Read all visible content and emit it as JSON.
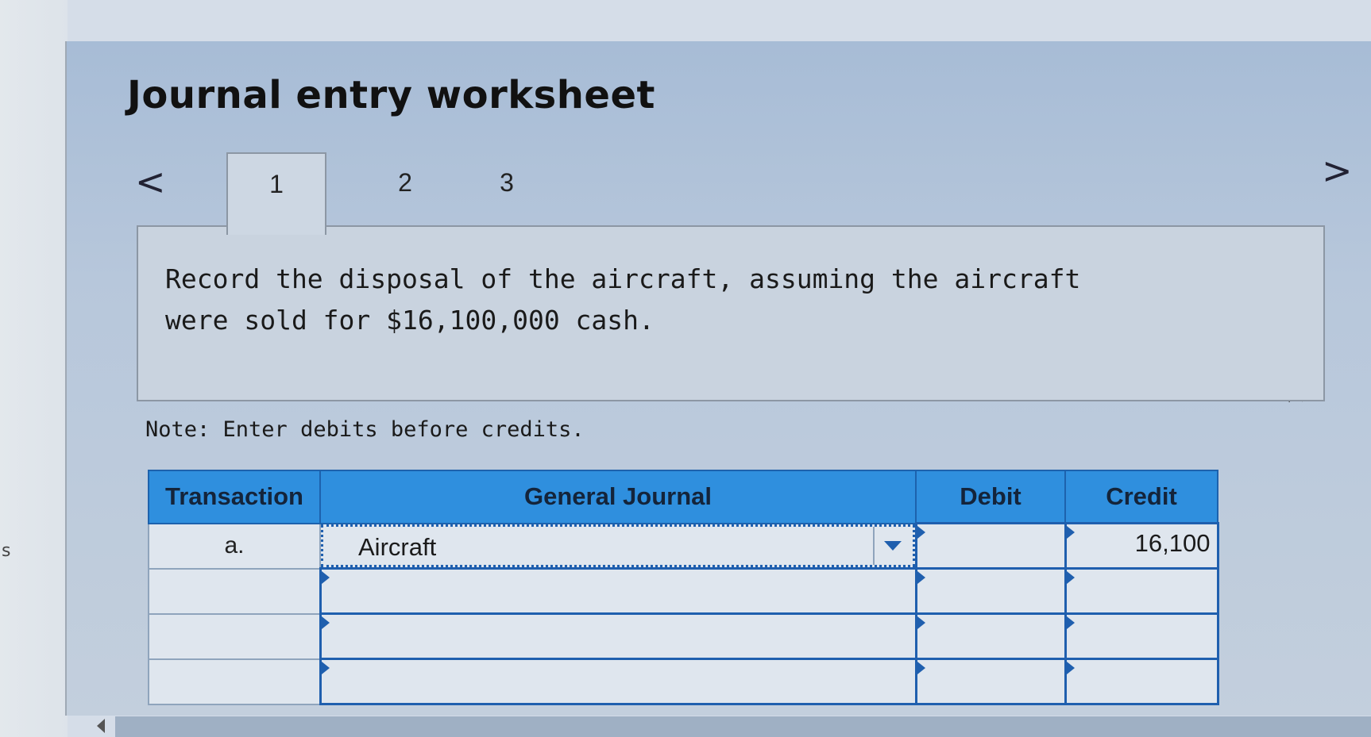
{
  "worksheet": {
    "title": "Journal entry worksheet",
    "prev_glyph": "<",
    "next_glyph": ">",
    "tabs": [
      {
        "label": "1",
        "active": true
      },
      {
        "label": "2",
        "active": false
      },
      {
        "label": "3",
        "active": false
      }
    ],
    "question": "Record the disposal of the aircraft, assuming the aircraft were sold for $16,100,000 cash.",
    "note": "Note: Enter debits before credits."
  },
  "journal": {
    "headers": {
      "transaction": "Transaction",
      "general_journal": "General Journal",
      "debit": "Debit",
      "credit": "Credit"
    },
    "rows": [
      {
        "transaction": "a.",
        "account": "Aircraft",
        "debit": "",
        "credit": "16,100"
      },
      {
        "transaction": "",
        "account": "",
        "debit": "",
        "credit": ""
      },
      {
        "transaction": "",
        "account": "",
        "debit": "",
        "credit": ""
      },
      {
        "transaction": "",
        "account": "",
        "debit": "",
        "credit": ""
      }
    ]
  },
  "edge_fragment": "s",
  "icons": {
    "prev": "chevron-left-icon",
    "next": "chevron-right-icon",
    "dropdown": "chevron-down-icon",
    "cursor": "mouse-cursor-icon"
  },
  "colors": {
    "header_blue": "#2f8fde",
    "input_border": "#1f5fae",
    "panel": "#a7bcd6"
  }
}
